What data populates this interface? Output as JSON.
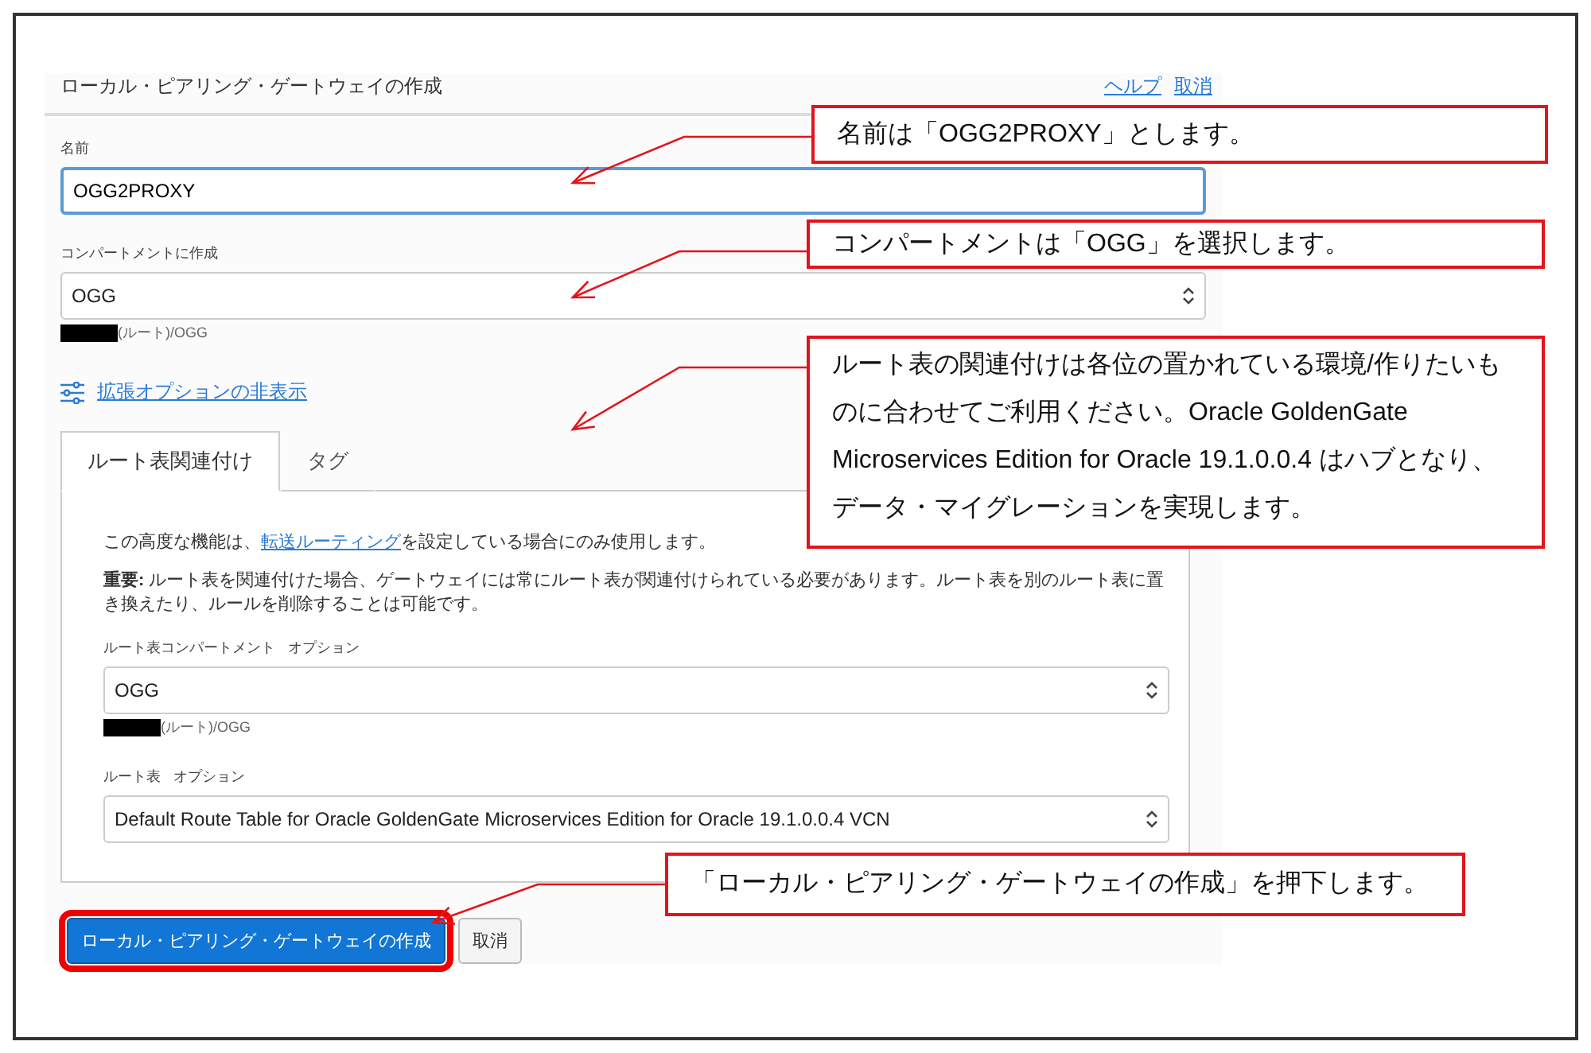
{
  "header": {
    "title": "ローカル・ピアリング・ゲートウェイの作成",
    "links": [
      "ヘルプ",
      "取消"
    ]
  },
  "name_field": {
    "label": "名前",
    "value": "OGG2PROXY",
    "focused": true
  },
  "compartment": {
    "label": "コンパートメントに作成",
    "value": "OGG",
    "path": "(ルート)/OGG"
  },
  "advanced_link": "拡張オプションの非表示",
  "tabs": [
    {
      "label": "ルート表関連付け",
      "selected": true
    },
    {
      "label": "タグ",
      "selected": false
    }
  ],
  "tab_panel": {
    "intro_before": "この高度な機能は、",
    "intro_link": "転送ルーティング",
    "intro_after": "を設定している場合にのみ使用します。",
    "note": "**重要:** ルート表を関連付けた場合、ゲートウェイには常にルート表が関連付けられている必要があります。ルート表を別のルート表に置き換えたり、ルールを削除することは可能です。",
    "route_compartment": {
      "label": "ルート表コンパートメント",
      "optional": "オプション",
      "value": "OGG",
      "path": "(ルート)/OGG"
    },
    "route_table": {
      "label": "ルート表",
      "optional": "オプション",
      "value": "Default Route Table for Oracle GoldenGate Microservices Edition for Oracle 19.1.0.0.4 VCN"
    }
  },
  "buttons": [
    {
      "label": "ローカル・ピアリング・ゲートウェイの作成",
      "kind": "primary",
      "highlighted": true
    },
    {
      "label": "取消",
      "kind": "secondary",
      "highlighted": false
    }
  ],
  "callouts": [
    "名前は「OGG2PROXY」とします。",
    "コンパートメントは「OGG」を選択します。",
    "ルート表の関連付けは各位の置かれている環境/作りたいものに合わせてご利用ください。Oracle GoldenGate Microservices Edition for Oracle 19.1.0.0.4 はハブとなり、データ・マイグレーションを実現します。",
    "「ローカル・ピアリング・ゲートウェイの作成」を押下します。"
  ]
}
